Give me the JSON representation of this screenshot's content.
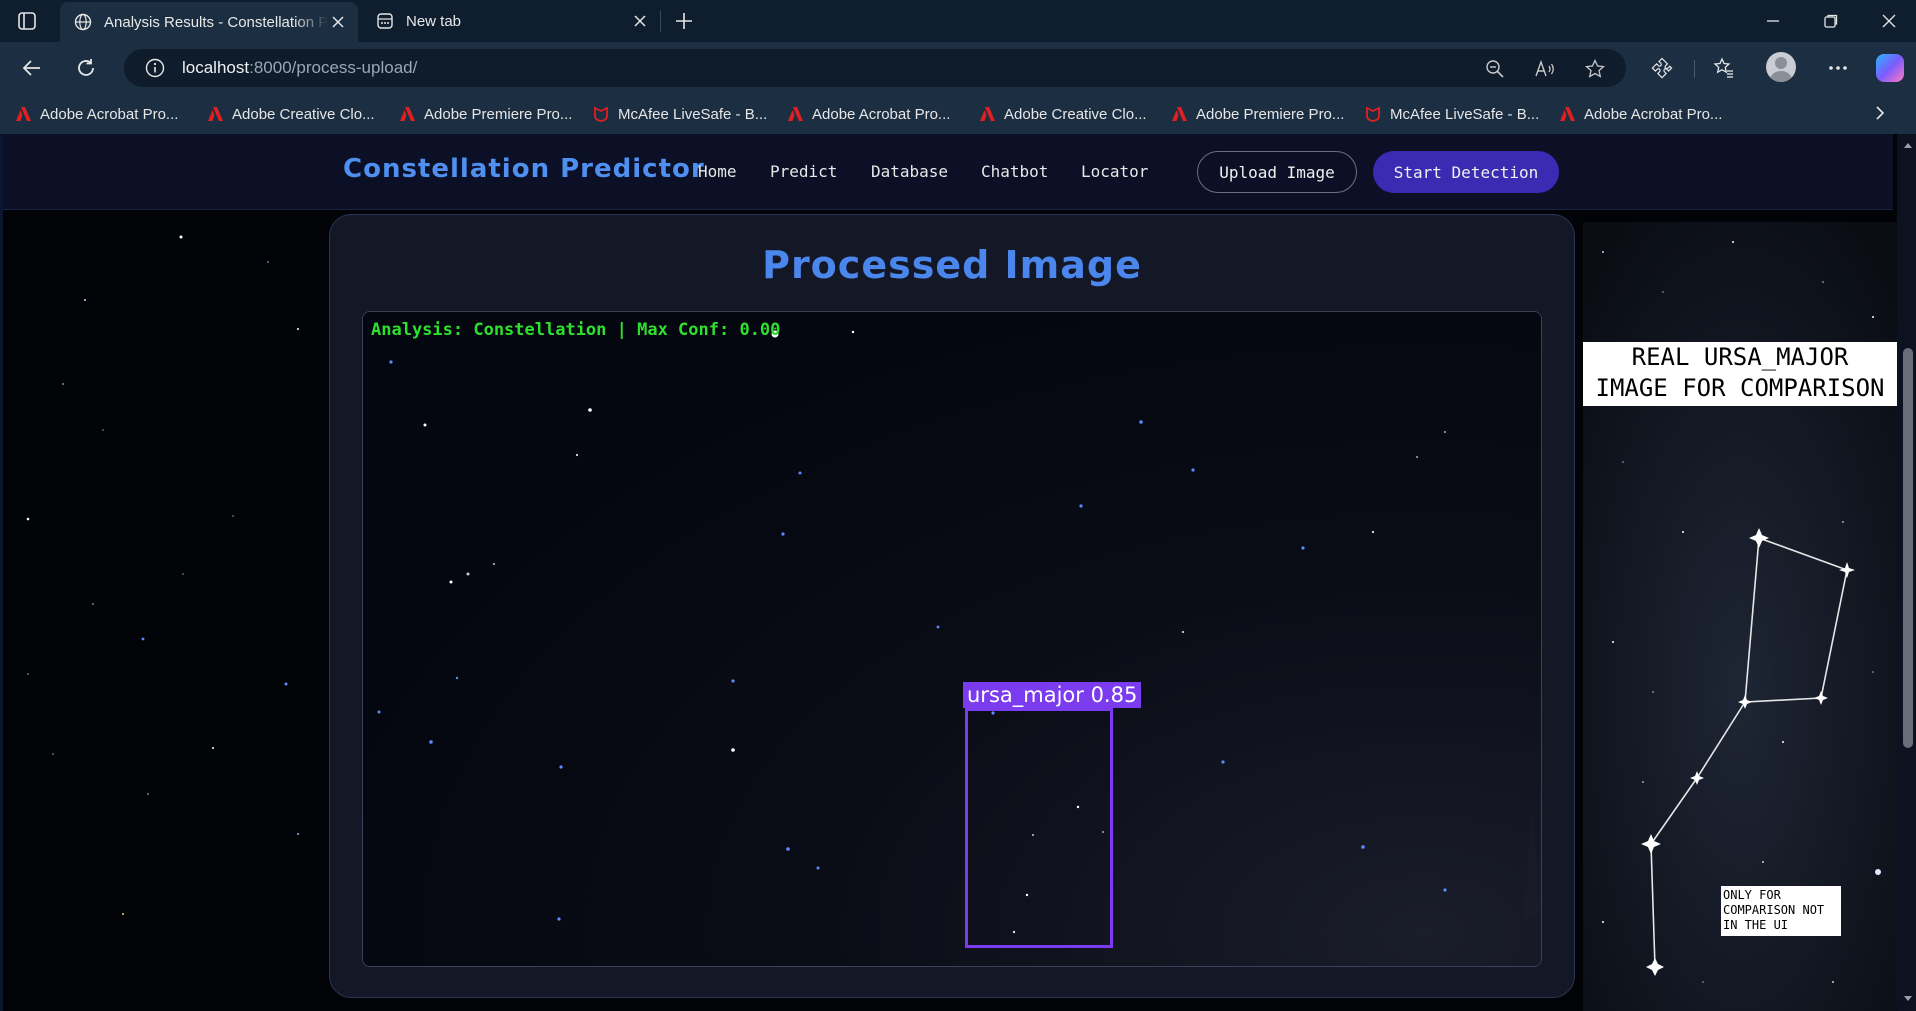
{
  "browser": {
    "tabs": [
      {
        "title": "Analysis Results - Constellation Predictor",
        "active": true
      },
      {
        "title": "New tab",
        "active": false
      }
    ],
    "address": {
      "host": "localhost",
      "path": ":8000/process-upload/"
    },
    "bookmarks": [
      {
        "label": "Adobe Acrobat Pro...",
        "icon": "adobe-icon"
      },
      {
        "label": "Adobe Creative Clo...",
        "icon": "adobe-icon"
      },
      {
        "label": "Adobe Premiere Pro...",
        "icon": "adobe-icon"
      },
      {
        "label": "McAfee LiveSafe - B...",
        "icon": "mcafee-icon"
      },
      {
        "label": "Adobe Acrobat Pro...",
        "icon": "adobe-icon"
      },
      {
        "label": "Adobe Creative Clo...",
        "icon": "adobe-icon"
      },
      {
        "label": "Adobe Premiere Pro...",
        "icon": "adobe-icon"
      },
      {
        "label": "McAfee LiveSafe - B...",
        "icon": "mcafee-icon"
      },
      {
        "label": "Adobe Acrobat Pro...",
        "icon": "adobe-icon"
      }
    ]
  },
  "app": {
    "brand": "Constellation Predictor",
    "nav": [
      "Home",
      "Predict",
      "Database",
      "Chatbot",
      "Locator"
    ],
    "upload_label": "Upload Image",
    "detect_label": "Start Detection",
    "colors": {
      "brand": "#4f8ff0",
      "accent": "#3a2bb3",
      "detection": "#7b3cf0",
      "analysis_text": "#2ee02e"
    }
  },
  "result": {
    "title": "Processed Image",
    "analysis_text": "Analysis: Constellation | Max Conf: 0.00",
    "detection_label": "ursa_major 0.85"
  },
  "comparison": {
    "banner_line1": "REAL URSA_MAJOR",
    "banner_line2": "IMAGE FOR COMPARISON",
    "note": "ONLY FOR COMPARISON NOT IN THE UI"
  }
}
